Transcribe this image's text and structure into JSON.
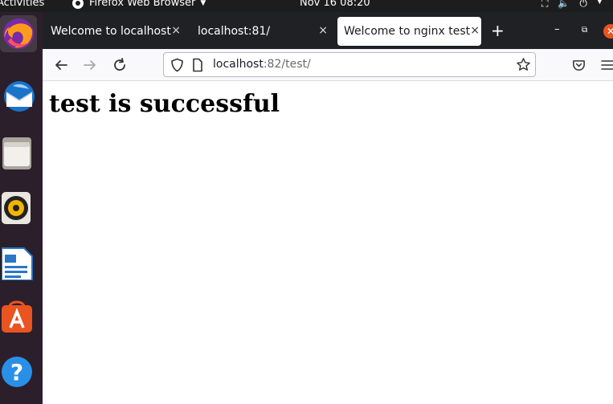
{
  "topbar": {
    "activities": "Activities",
    "app_name": "Firefox Web Browser",
    "clock": "Nov 16  08:20"
  },
  "dock": {
    "items": [
      "firefox-icon",
      "thunderbird-icon",
      "files-icon",
      "rhythmbox-icon",
      "writer-icon",
      "software-icon",
      "help-icon"
    ]
  },
  "browser": {
    "tabs": [
      {
        "label": "Welcome to localhost"
      },
      {
        "label": "localhost:81/"
      },
      {
        "label": "Welcome to nginx test"
      }
    ],
    "close_glyph": "×",
    "new_tab_glyph": "+",
    "url_host": "localhost",
    "url_rest": ":82/test/"
  },
  "content": {
    "heading": "test is successful"
  },
  "colors": {
    "topbar": "#1d1d1d",
    "dock": "#2b1f2b",
    "tabstrip": "#202124",
    "ubuntu_orange": "#e95420"
  }
}
